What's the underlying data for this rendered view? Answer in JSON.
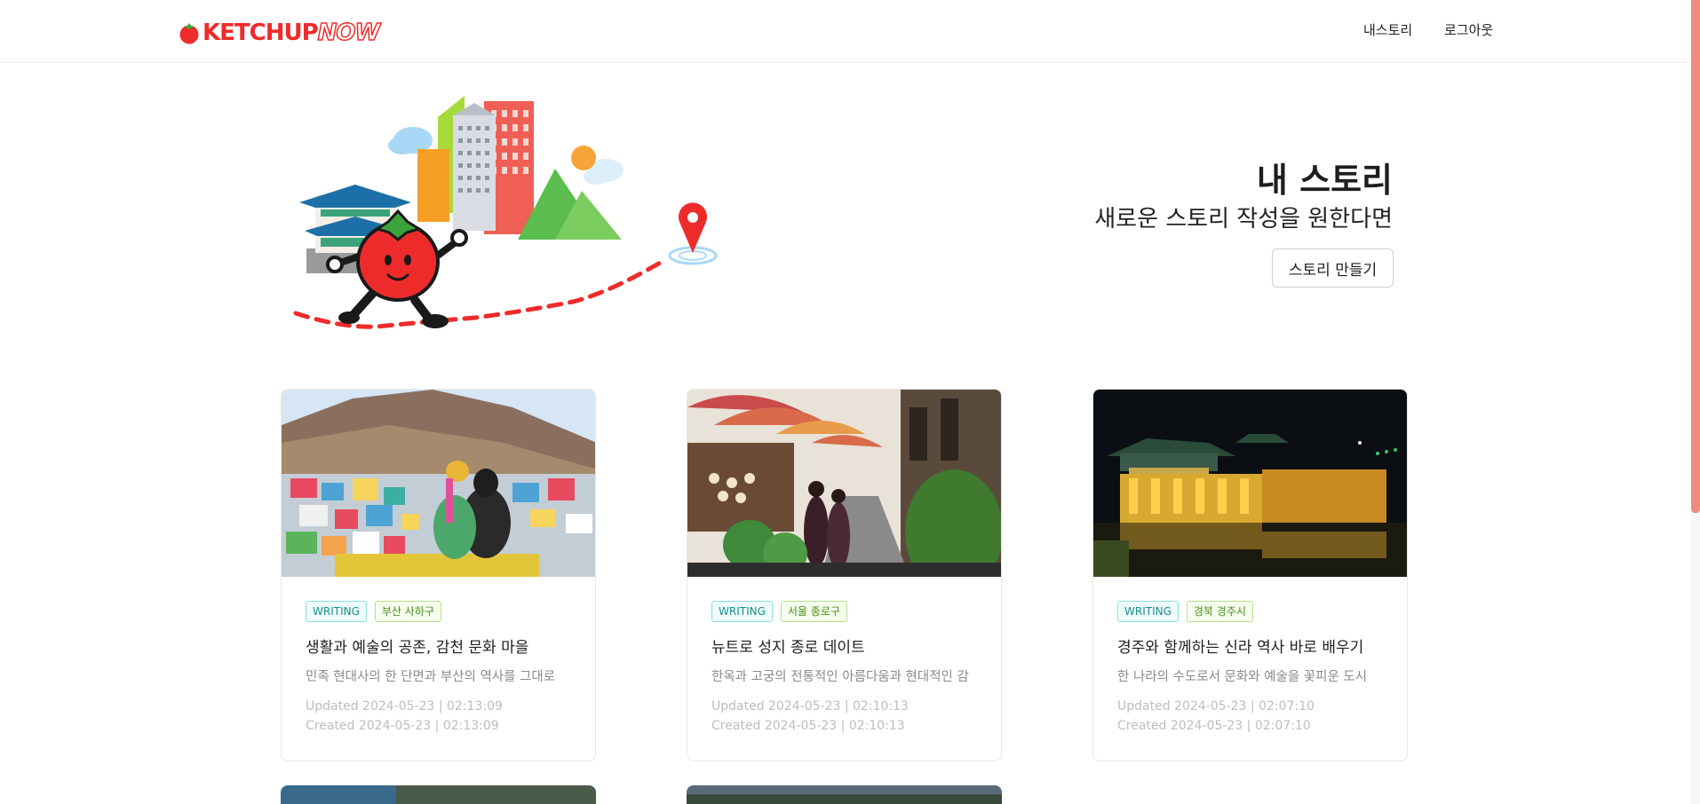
{
  "header": {
    "logo_primary": "KETCHUP",
    "logo_secondary": "NOW",
    "nav": {
      "my_story": "내스토리",
      "logout": "로그아웃"
    }
  },
  "hero": {
    "title": "내 스토리",
    "subtitle": "새로운 스토리 작성을 원한다면",
    "create_button": "스토리 만들기"
  },
  "cards": [
    {
      "tag_type": "WRITING",
      "tag_region": "부산 사하구",
      "title": "생활과 예술의 공존, 감천 문화 마을",
      "description": "민족 현대사의 한 단면과 부산의 역사를 그대로",
      "updated": "Updated 2024-05-23 | 02:13:09",
      "created": "Created 2024-05-23 | 02:13:09"
    },
    {
      "tag_type": "WRITING",
      "tag_region": "서울 종로구",
      "title": "뉴트로 성지 종로 데이트",
      "description": "한옥과 고궁의 전통적인 아름다움과 현대적인 감",
      "updated": "Updated 2024-05-23 | 02:10:13",
      "created": "Created 2024-05-23 | 02:10:13"
    },
    {
      "tag_type": "WRITING",
      "tag_region": "경북 경주시",
      "title": "경주와 함께하는 신라 역사 바로 배우기",
      "description": "한 나라의 수도로서 문화와 예술을 꽃피운 도시",
      "updated": "Updated 2024-05-23 | 02:07:10",
      "created": "Created 2024-05-23 | 02:07:10"
    }
  ],
  "colors": {
    "brand": "#ee2b2b",
    "scroll_thumb": "#f38a7e",
    "tag_writing": "#1a8d8d",
    "tag_region": "#4b8a1d"
  }
}
